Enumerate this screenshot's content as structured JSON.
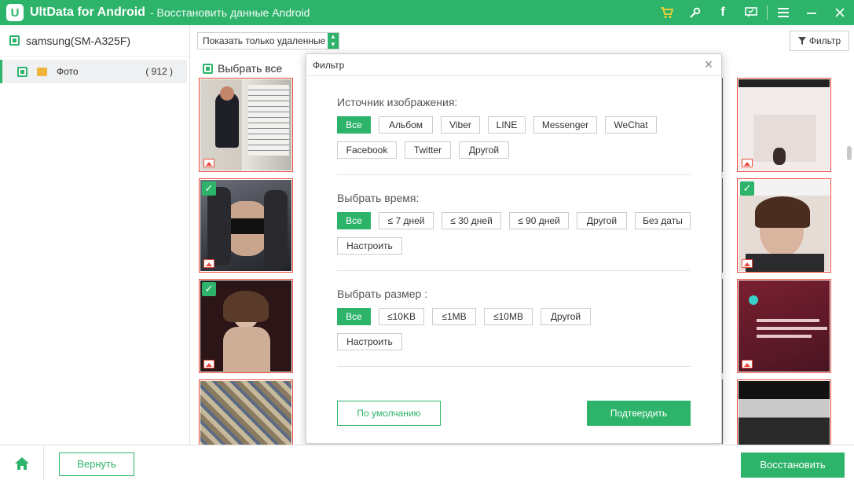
{
  "titlebar": {
    "logo_letter": "U",
    "app_name": "UltData for Android",
    "subtitle": "- Восстановить данные Android",
    "icons": [
      "cart-icon",
      "wrench-icon",
      "facebook-icon",
      "feedback-icon",
      "menu-icon",
      "minimize-icon",
      "close-icon"
    ],
    "accent": "#2db46a"
  },
  "sidebar": {
    "device": "samsung(SM-A325F)",
    "items": [
      {
        "label": "Фото",
        "count": "( 912 )"
      }
    ]
  },
  "toolbar": {
    "show_deleted": "Показать только удаленные",
    "filter_label": "Фильтр"
  },
  "grid": {
    "select_all": "Выбрать все"
  },
  "modal": {
    "title": "Фильтр",
    "close": "×",
    "source": {
      "title": "Источник изображения:",
      "options": [
        "Все",
        "Альбом",
        "Viber",
        "LINE",
        "Messenger",
        "WeChat",
        "Facebook",
        "Twitter",
        "Другой"
      ]
    },
    "time": {
      "title": "Выбрать время:",
      "options": [
        "Все",
        "≤ 7 дней",
        "≤ 30 дней",
        "≤ 90 дней",
        "Другой",
        "Без даты",
        "Настроить"
      ]
    },
    "size": {
      "title": "Выбрать размер :",
      "options": [
        "Все",
        "≤10KB",
        "≤1MB",
        "≤10MB",
        "Другой",
        "Настроить"
      ]
    },
    "default_label": "По умолчанию",
    "confirm_label": "Подтвердить"
  },
  "footer": {
    "back_label": "Вернуть",
    "restore_label": "Восстановить"
  }
}
